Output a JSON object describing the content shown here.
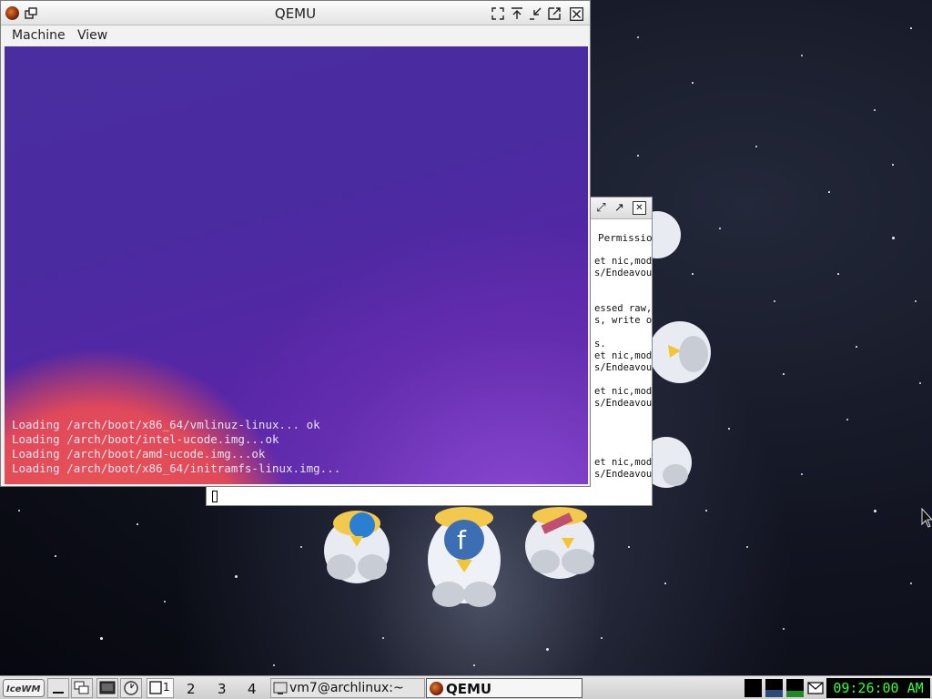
{
  "qemu_window": {
    "title": "QEMU",
    "menu": [
      "Machine",
      "View"
    ],
    "boot_output": [
      "Loading /arch/boot/x86_64/vmlinuz-linux... ok",
      "Loading /arch/boot/intel-ucode.img...ok",
      "Loading /arch/boot/amd-ucode.img...ok",
      "Loading /arch/boot/x86_64/initramfs-linux.img..."
    ]
  },
  "terminal_window": {
    "visible_fragments": [
      "Permissio",
      "et nic,mod",
      "s/Endeavou",
      "essed raw,",
      "s, write o",
      "s.",
      "et nic,mod",
      "s/Endeavou",
      "et nic,mod",
      "s/Endeavou",
      "et nic,mod",
      "s/Endeavou"
    ]
  },
  "taskbar": {
    "workspaces": [
      "1",
      "2",
      "3",
      "4"
    ],
    "tasks": [
      {
        "label": "vm7@archlinux:~",
        "icon": "terminal-icon"
      },
      {
        "label": "QEMU",
        "icon": "qemu-icon"
      }
    ],
    "clock": "09:26:00 AM",
    "colors": {
      "clock_text": "#2fff3b",
      "clock_bg": "#000000"
    }
  }
}
